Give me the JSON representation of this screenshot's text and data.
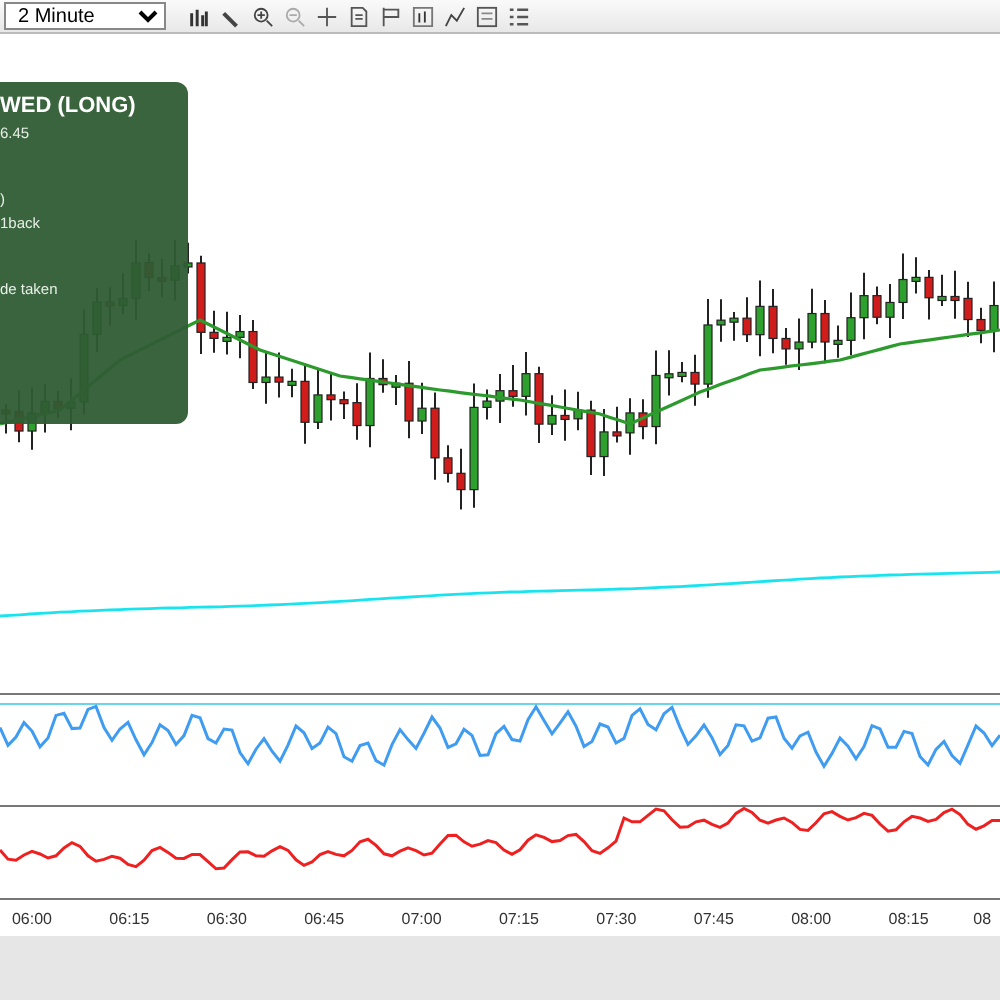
{
  "toolbar": {
    "timeframe": "2 Minute"
  },
  "overlay": {
    "lines": [
      {
        "kind": "title",
        "text": "WED (LONG)"
      },
      {
        "kind": "line",
        "text": "6.45"
      },
      {
        "kind": "gap",
        "text": ")"
      },
      {
        "kind": "line",
        "text": "1back"
      },
      {
        "kind": "gap",
        "text": "de taken"
      }
    ]
  },
  "x_axis": {
    "ticks": [
      "06:00",
      "06:15",
      "06:30",
      "06:45",
      "07:00",
      "07:15",
      "07:30",
      "07:45",
      "08:00",
      "08:15",
      "08"
    ]
  }
}
